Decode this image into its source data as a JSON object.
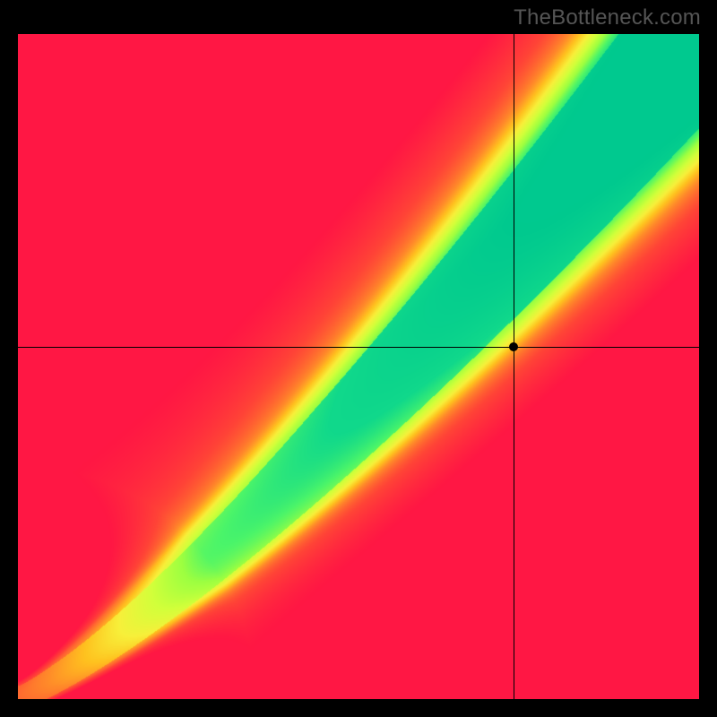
{
  "watermark": "TheBottleneck.com",
  "chart_data": {
    "type": "heatmap",
    "title": "",
    "xlabel": "",
    "ylabel": "",
    "xlim": [
      0,
      1
    ],
    "ylim": [
      0,
      1
    ],
    "crosshair": {
      "x": 0.727,
      "y": 0.529
    },
    "marker": {
      "x": 0.727,
      "y": 0.529
    },
    "color_stops": [
      {
        "t": -1.0,
        "color": "#ff1744"
      },
      {
        "t": -0.7,
        "color": "#ff4437"
      },
      {
        "t": -0.4,
        "color": "#ff8a2a"
      },
      {
        "t": -0.2,
        "color": "#ffc21f"
      },
      {
        "t": 0.0,
        "color": "#f8f03a"
      },
      {
        "t": 0.2,
        "color": "#d4ff3a"
      },
      {
        "t": 0.4,
        "color": "#9dff41"
      },
      {
        "t": 0.55,
        "color": "#4bf56a"
      },
      {
        "t": 0.7,
        "color": "#11d98b"
      },
      {
        "t": 1.0,
        "color": "#00c98f"
      }
    ],
    "field": {
      "type": "diagonal-ridge",
      "band_center_power": 1.25,
      "band_halfwidth": 0.055,
      "soft_falloff": 0.55,
      "origin_pull": 0.65
    }
  }
}
